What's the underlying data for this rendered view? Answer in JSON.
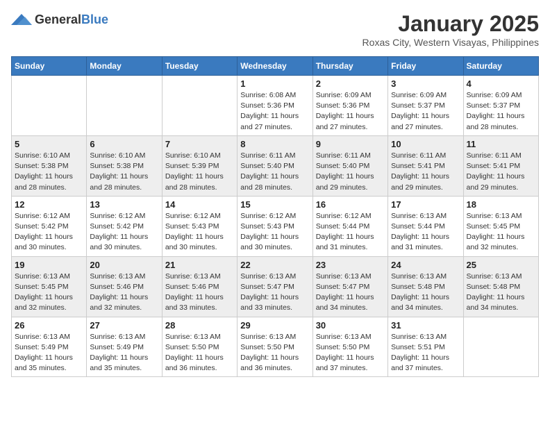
{
  "header": {
    "logo_general": "General",
    "logo_blue": "Blue",
    "month_title": "January 2025",
    "subtitle": "Roxas City, Western Visayas, Philippines"
  },
  "weekdays": [
    "Sunday",
    "Monday",
    "Tuesday",
    "Wednesday",
    "Thursday",
    "Friday",
    "Saturday"
  ],
  "weeks": [
    [
      {
        "day": "",
        "info": ""
      },
      {
        "day": "",
        "info": ""
      },
      {
        "day": "",
        "info": ""
      },
      {
        "day": "1",
        "sunrise": "Sunrise: 6:08 AM",
        "sunset": "Sunset: 5:36 PM",
        "daylight": "Daylight: 11 hours and 27 minutes."
      },
      {
        "day": "2",
        "sunrise": "Sunrise: 6:09 AM",
        "sunset": "Sunset: 5:36 PM",
        "daylight": "Daylight: 11 hours and 27 minutes."
      },
      {
        "day": "3",
        "sunrise": "Sunrise: 6:09 AM",
        "sunset": "Sunset: 5:37 PM",
        "daylight": "Daylight: 11 hours and 27 minutes."
      },
      {
        "day": "4",
        "sunrise": "Sunrise: 6:09 AM",
        "sunset": "Sunset: 5:37 PM",
        "daylight": "Daylight: 11 hours and 28 minutes."
      }
    ],
    [
      {
        "day": "5",
        "sunrise": "Sunrise: 6:10 AM",
        "sunset": "Sunset: 5:38 PM",
        "daylight": "Daylight: 11 hours and 28 minutes."
      },
      {
        "day": "6",
        "sunrise": "Sunrise: 6:10 AM",
        "sunset": "Sunset: 5:38 PM",
        "daylight": "Daylight: 11 hours and 28 minutes."
      },
      {
        "day": "7",
        "sunrise": "Sunrise: 6:10 AM",
        "sunset": "Sunset: 5:39 PM",
        "daylight": "Daylight: 11 hours and 28 minutes."
      },
      {
        "day": "8",
        "sunrise": "Sunrise: 6:11 AM",
        "sunset": "Sunset: 5:40 PM",
        "daylight": "Daylight: 11 hours and 28 minutes."
      },
      {
        "day": "9",
        "sunrise": "Sunrise: 6:11 AM",
        "sunset": "Sunset: 5:40 PM",
        "daylight": "Daylight: 11 hours and 29 minutes."
      },
      {
        "day": "10",
        "sunrise": "Sunrise: 6:11 AM",
        "sunset": "Sunset: 5:41 PM",
        "daylight": "Daylight: 11 hours and 29 minutes."
      },
      {
        "day": "11",
        "sunrise": "Sunrise: 6:11 AM",
        "sunset": "Sunset: 5:41 PM",
        "daylight": "Daylight: 11 hours and 29 minutes."
      }
    ],
    [
      {
        "day": "12",
        "sunrise": "Sunrise: 6:12 AM",
        "sunset": "Sunset: 5:42 PM",
        "daylight": "Daylight: 11 hours and 30 minutes."
      },
      {
        "day": "13",
        "sunrise": "Sunrise: 6:12 AM",
        "sunset": "Sunset: 5:42 PM",
        "daylight": "Daylight: 11 hours and 30 minutes."
      },
      {
        "day": "14",
        "sunrise": "Sunrise: 6:12 AM",
        "sunset": "Sunset: 5:43 PM",
        "daylight": "Daylight: 11 hours and 30 minutes."
      },
      {
        "day": "15",
        "sunrise": "Sunrise: 6:12 AM",
        "sunset": "Sunset: 5:43 PM",
        "daylight": "Daylight: 11 hours and 30 minutes."
      },
      {
        "day": "16",
        "sunrise": "Sunrise: 6:12 AM",
        "sunset": "Sunset: 5:44 PM",
        "daylight": "Daylight: 11 hours and 31 minutes."
      },
      {
        "day": "17",
        "sunrise": "Sunrise: 6:13 AM",
        "sunset": "Sunset: 5:44 PM",
        "daylight": "Daylight: 11 hours and 31 minutes."
      },
      {
        "day": "18",
        "sunrise": "Sunrise: 6:13 AM",
        "sunset": "Sunset: 5:45 PM",
        "daylight": "Daylight: 11 hours and 32 minutes."
      }
    ],
    [
      {
        "day": "19",
        "sunrise": "Sunrise: 6:13 AM",
        "sunset": "Sunset: 5:45 PM",
        "daylight": "Daylight: 11 hours and 32 minutes."
      },
      {
        "day": "20",
        "sunrise": "Sunrise: 6:13 AM",
        "sunset": "Sunset: 5:46 PM",
        "daylight": "Daylight: 11 hours and 32 minutes."
      },
      {
        "day": "21",
        "sunrise": "Sunrise: 6:13 AM",
        "sunset": "Sunset: 5:46 PM",
        "daylight": "Daylight: 11 hours and 33 minutes."
      },
      {
        "day": "22",
        "sunrise": "Sunrise: 6:13 AM",
        "sunset": "Sunset: 5:47 PM",
        "daylight": "Daylight: 11 hours and 33 minutes."
      },
      {
        "day": "23",
        "sunrise": "Sunrise: 6:13 AM",
        "sunset": "Sunset: 5:47 PM",
        "daylight": "Daylight: 11 hours and 34 minutes."
      },
      {
        "day": "24",
        "sunrise": "Sunrise: 6:13 AM",
        "sunset": "Sunset: 5:48 PM",
        "daylight": "Daylight: 11 hours and 34 minutes."
      },
      {
        "day": "25",
        "sunrise": "Sunrise: 6:13 AM",
        "sunset": "Sunset: 5:48 PM",
        "daylight": "Daylight: 11 hours and 34 minutes."
      }
    ],
    [
      {
        "day": "26",
        "sunrise": "Sunrise: 6:13 AM",
        "sunset": "Sunset: 5:49 PM",
        "daylight": "Daylight: 11 hours and 35 minutes."
      },
      {
        "day": "27",
        "sunrise": "Sunrise: 6:13 AM",
        "sunset": "Sunset: 5:49 PM",
        "daylight": "Daylight: 11 hours and 35 minutes."
      },
      {
        "day": "28",
        "sunrise": "Sunrise: 6:13 AM",
        "sunset": "Sunset: 5:50 PM",
        "daylight": "Daylight: 11 hours and 36 minutes."
      },
      {
        "day": "29",
        "sunrise": "Sunrise: 6:13 AM",
        "sunset": "Sunset: 5:50 PM",
        "daylight": "Daylight: 11 hours and 36 minutes."
      },
      {
        "day": "30",
        "sunrise": "Sunrise: 6:13 AM",
        "sunset": "Sunset: 5:50 PM",
        "daylight": "Daylight: 11 hours and 37 minutes."
      },
      {
        "day": "31",
        "sunrise": "Sunrise: 6:13 AM",
        "sunset": "Sunset: 5:51 PM",
        "daylight": "Daylight: 11 hours and 37 minutes."
      },
      {
        "day": "",
        "info": ""
      }
    ]
  ]
}
